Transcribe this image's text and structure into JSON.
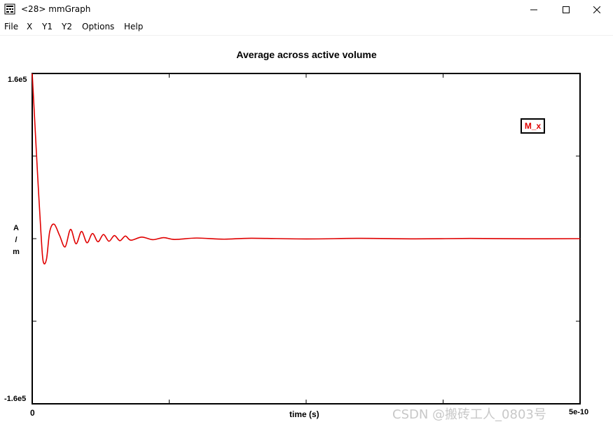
{
  "window": {
    "title": "<28> mmGraph",
    "icon": "mmgraph-app-icon",
    "controls": [
      "minimize-icon",
      "maximize-icon",
      "close-icon"
    ]
  },
  "menu": {
    "file": "File",
    "x": "X",
    "y1": "Y1",
    "y2": "Y2",
    "options": "Options",
    "help": "Help"
  },
  "chart_data": {
    "type": "line",
    "title": "Average across active volume",
    "xlabel": "time (s)",
    "ylabel": "A / m",
    "ylabel_lines": [
      "A",
      "/",
      "m"
    ],
    "xlim": [
      0,
      5e-10
    ],
    "ylim": [
      -160000,
      160000
    ],
    "x_tick_labels": {
      "left": "0",
      "right": "5e-10"
    },
    "y_tick_labels": {
      "top": "1.6e5",
      "bottom": "-1.6e5"
    },
    "grid": false,
    "legend_position": "top-right",
    "series": [
      {
        "name": "M_x",
        "color": "#e00000",
        "x": [
          0,
          2e-12,
          5e-12,
          8e-12,
          1e-11,
          1.3e-11,
          1.6e-11,
          2e-11,
          2.5e-11,
          3e-11,
          3.5e-11,
          4e-11,
          4.5e-11,
          5e-11,
          5.5e-11,
          6e-11,
          6.5e-11,
          7e-11,
          7.5e-11,
          8e-11,
          8.5e-11,
          9e-11,
          1e-10,
          1.1e-10,
          1.2e-10,
          1.3e-10,
          1.5e-10,
          1.75e-10,
          2e-10,
          2.5e-10,
          3e-10,
          3.5e-10,
          4e-10,
          4.5e-10,
          5e-10
        ],
        "y": [
          160000,
          120000,
          60000,
          5000,
          -22000,
          -20000,
          7000,
          14000,
          3000,
          -8000,
          9000,
          -5000,
          7000,
          -4000,
          5000,
          -3000,
          4000,
          -2500,
          3000,
          -2000,
          2500,
          -1500,
          1500,
          -1000,
          1000,
          -800,
          600,
          -500,
          400,
          -300,
          300,
          -200,
          200,
          -150,
          0
        ]
      }
    ]
  },
  "watermark": "CSDN @搬砖工人_0803号"
}
